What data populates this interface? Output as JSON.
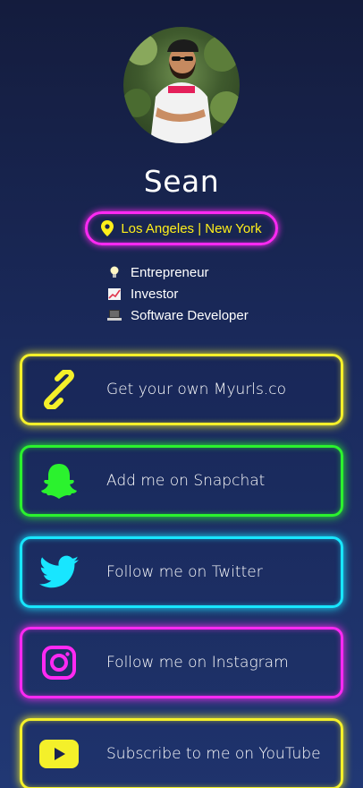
{
  "profile": {
    "name": "Sean",
    "location": "Los Angeles | New York",
    "bio": [
      {
        "icon": "lightbulb-emoji",
        "text": "Entrepreneur"
      },
      {
        "icon": "chart-increasing-emoji",
        "text": "Investor"
      },
      {
        "icon": "laptop-emoji",
        "text": "Software Developer"
      }
    ]
  },
  "links": [
    {
      "label": "Get your own Myurls.co",
      "icon": "link-icon",
      "color": "#f4f02a"
    },
    {
      "label": "Add me on Snapchat",
      "icon": "snapchat-icon",
      "color": "#2bf22e"
    },
    {
      "label": "Follow me on Twitter",
      "icon": "twitter-icon",
      "color": "#18e6ff"
    },
    {
      "label": "Follow me on Instagram",
      "icon": "instagram-icon",
      "color": "#ff29f3"
    },
    {
      "label": "Subscribe to me on YouTube",
      "icon": "youtube-icon",
      "color": "#f4f02a"
    }
  ],
  "colors": {
    "location_text": "#ffef1a",
    "location_border": "#ff29f3"
  }
}
